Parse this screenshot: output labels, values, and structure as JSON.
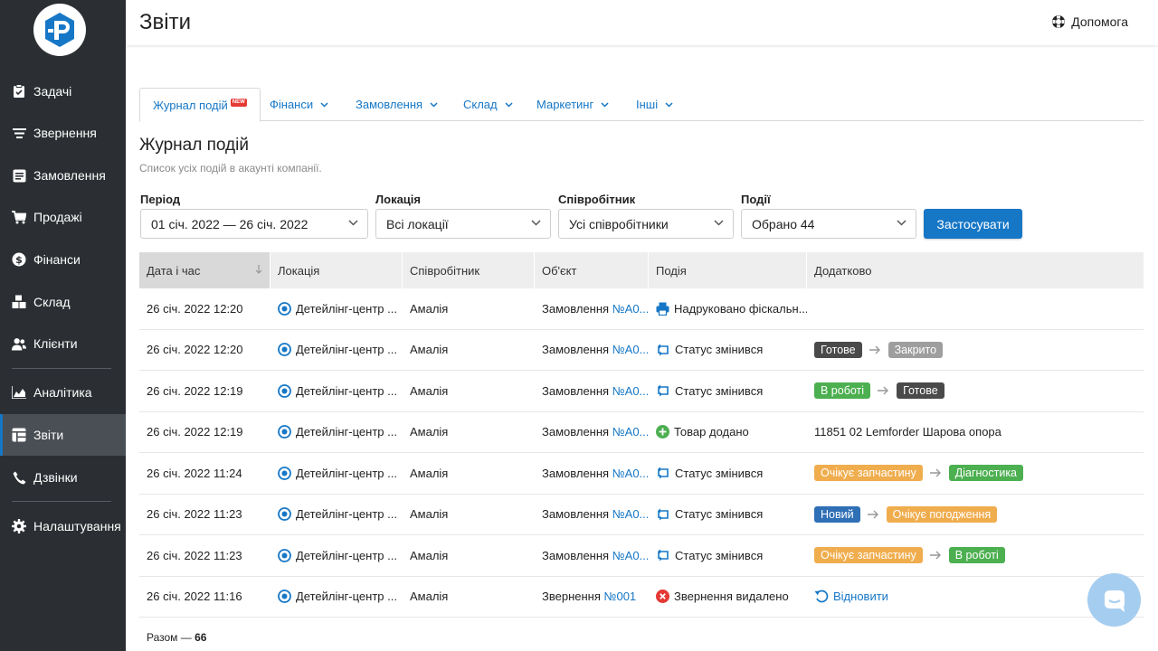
{
  "app": {
    "title": "Звіти",
    "help_label": "Допомога"
  },
  "sidebar": {
    "items": [
      {
        "label": "Задачі",
        "icon": "clipboard-check-icon"
      },
      {
        "label": "Звернення",
        "icon": "filter-lines-icon"
      },
      {
        "label": "Замовлення",
        "icon": "order-list-icon"
      },
      {
        "label": "Продажі",
        "icon": "shopping-cart-icon"
      },
      {
        "label": "Фінанси",
        "icon": "dollar-circle-icon"
      },
      {
        "label": "Склад",
        "icon": "boxes-icon"
      },
      {
        "label": "Клієнти",
        "icon": "users-icon"
      },
      {
        "label": "Аналітика",
        "icon": "area-chart-icon"
      },
      {
        "label": "Звіти",
        "icon": "table-icon",
        "active": true
      },
      {
        "label": "Дзвінки",
        "icon": "phone-icon"
      },
      {
        "label": "Налаштування",
        "icon": "gear-icon"
      }
    ]
  },
  "tabs": [
    {
      "label": "Журнал подій",
      "badge": "NEW",
      "active": true
    },
    {
      "label": "Фінанси"
    },
    {
      "label": "Замовлення"
    },
    {
      "label": "Склад"
    },
    {
      "label": "Маркетинг"
    },
    {
      "label": "Інші"
    }
  ],
  "section": {
    "title": "Журнал подій",
    "subtitle": "Список усіх подій в акаунті компанії."
  },
  "filters": {
    "period": {
      "label": "Період",
      "value": "01 січ. 2022 — 26 січ. 2022"
    },
    "location": {
      "label": "Локація",
      "value": "Всі локації"
    },
    "employee": {
      "label": "Співробітник",
      "value": "Усі співробітники"
    },
    "events": {
      "label": "Події",
      "value": "Обрано 44"
    },
    "apply_label": "Застосувати"
  },
  "table": {
    "headers": [
      "Дата і час",
      "Локація",
      "Співробітник",
      "Об'єкт",
      "Подія",
      "Додатково"
    ],
    "rows": [
      {
        "datetime": "26 січ. 2022 12:20",
        "location": "Детейлінг-центр ...",
        "employee": "Амалія",
        "object_type": "Замовлення",
        "object_num": "№A0...",
        "event_icon": "printer-icon",
        "event": "Надруковано фіскальн...",
        "extra": null
      },
      {
        "datetime": "26 січ. 2022 12:20",
        "location": "Детейлінг-центр ...",
        "employee": "Амалія",
        "object_type": "Замовлення",
        "object_num": "№A0...",
        "event_icon": "status-change-icon",
        "event": "Статус змінився",
        "extra": {
          "from": "Готове",
          "to": "Закрито",
          "from_color": "#4a4a4a",
          "to_color": "#9e9e9e"
        }
      },
      {
        "datetime": "26 січ. 2022 12:19",
        "location": "Детейлінг-центр ...",
        "employee": "Амалія",
        "object_type": "Замовлення",
        "object_num": "№A0...",
        "event_icon": "status-change-icon",
        "event": "Статус змінився",
        "extra": {
          "from": "В роботі",
          "to": "Готове",
          "from_color": "#4caf50",
          "to_color": "#4a4a4a"
        }
      },
      {
        "datetime": "26 січ. 2022 12:19",
        "location": "Детейлінг-центр ...",
        "employee": "Амалія",
        "object_type": "Замовлення",
        "object_num": "№A0...",
        "event_icon": "plus-circle-icon",
        "event": "Товар додано",
        "extra_text": "11851 02 Lemforder Шарова опора"
      },
      {
        "datetime": "26 січ. 2022 11:24",
        "location": "Детейлінг-центр ...",
        "employee": "Амалія",
        "object_type": "Замовлення",
        "object_num": "№A0...",
        "event_icon": "status-change-icon",
        "event": "Статус змінився",
        "extra": {
          "from": "Очікує запчастину",
          "to": "Діагностика",
          "from_color": "#f0ad4e",
          "to_color": "#4caf50"
        }
      },
      {
        "datetime": "26 січ. 2022 11:23",
        "location": "Детейлінг-центр ...",
        "employee": "Амалія",
        "object_type": "Замовлення",
        "object_num": "№A0...",
        "event_icon": "status-change-icon",
        "event": "Статус змінився",
        "extra": {
          "from": "Новий",
          "to": "Очікує погодження",
          "from_color": "#2f6fb5",
          "to_color": "#f0ad4e"
        }
      },
      {
        "datetime": "26 січ. 2022 11:23",
        "location": "Детейлінг-центр ...",
        "employee": "Амалія",
        "object_type": "Замовлення",
        "object_num": "№A0...",
        "event_icon": "status-change-icon",
        "event": "Статус змінився",
        "extra": {
          "from": "Очікує запчастину",
          "to": "В роботі",
          "from_color": "#f0ad4e",
          "to_color": "#4caf50"
        }
      },
      {
        "datetime": "26 січ. 2022 11:16",
        "location": "Детейлінг-центр ...",
        "employee": "Амалія",
        "object_type": "Звернення",
        "object_num": "№001",
        "event_icon": "x-circle-icon",
        "event": "Звернення видалено",
        "restore_label": "Відновити"
      }
    ]
  },
  "footer": {
    "total_label": "Разом —",
    "total_value": "66"
  },
  "colors": {
    "accent": "#1677c6",
    "sidebar": "#2b2f33"
  }
}
